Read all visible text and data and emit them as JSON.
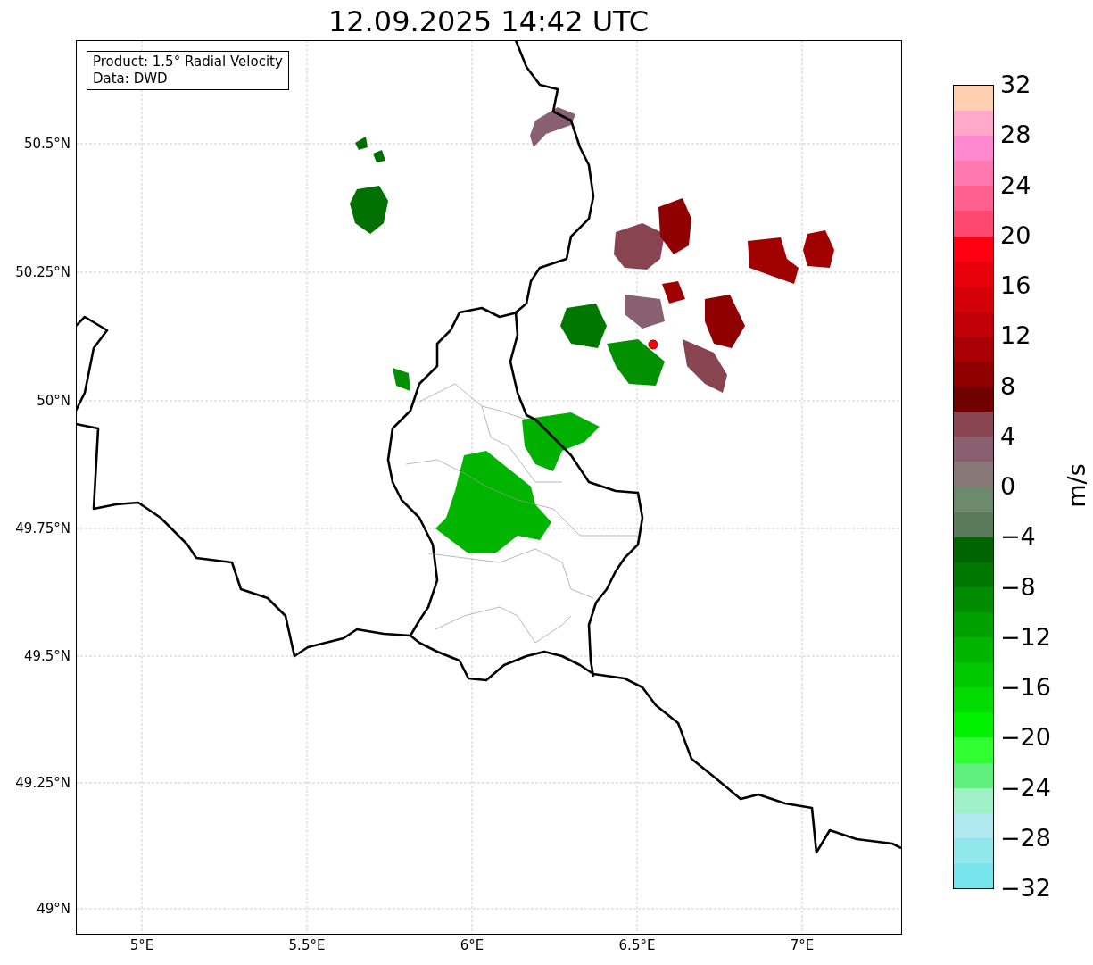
{
  "title": "12.09.2025 14:42 UTC",
  "map": {
    "info_box": [
      "Product: 1.5° Radial Velocity",
      "Data: DWD"
    ],
    "lat_labels": [
      "50.5°N",
      "50.25°N",
      "50°N",
      "49.75°N",
      "49.5°N",
      "49.25°N",
      "49°N"
    ],
    "lon_labels": [
      "5°E",
      "5.5°E",
      "6°E",
      "6.5°E",
      "7°E"
    ]
  },
  "colorbar": {
    "label": "m/s",
    "ticks": [
      "32",
      "28",
      "24",
      "20",
      "16",
      "12",
      "8",
      "4",
      "0",
      "−4",
      "−8",
      "−12",
      "−16",
      "−20",
      "−24",
      "−28",
      "−32"
    ],
    "segments": [
      {
        "color": "#ffcfb0"
      },
      {
        "color": "#ffa8c8"
      },
      {
        "color": "#ff88d0"
      },
      {
        "color": "#ff78b0"
      },
      {
        "color": "#ff6090"
      },
      {
        "color": "#ff4870"
      },
      {
        "color": "#ff0010"
      },
      {
        "color": "#e8000a"
      },
      {
        "color": "#d40008"
      },
      {
        "color": "#c00006"
      },
      {
        "color": "#a80004"
      },
      {
        "color": "#900000"
      },
      {
        "color": "#6e0000"
      },
      {
        "color": "#884450"
      },
      {
        "color": "#886070"
      },
      {
        "color": "#887878"
      },
      {
        "color": "#6e8a6e"
      },
      {
        "color": "#5a7a5a"
      },
      {
        "color": "#006400"
      },
      {
        "color": "#007800"
      },
      {
        "color": "#008c00"
      },
      {
        "color": "#00a000"
      },
      {
        "color": "#00b400"
      },
      {
        "color": "#00c800"
      },
      {
        "color": "#00dc00"
      },
      {
        "color": "#00f000"
      },
      {
        "color": "#30ff30"
      },
      {
        "color": "#60f080"
      },
      {
        "color": "#a0f0c8"
      },
      {
        "color": "#b0e8f0"
      },
      {
        "color": "#90e8ec"
      },
      {
        "color": "#78e4ec"
      }
    ]
  }
}
